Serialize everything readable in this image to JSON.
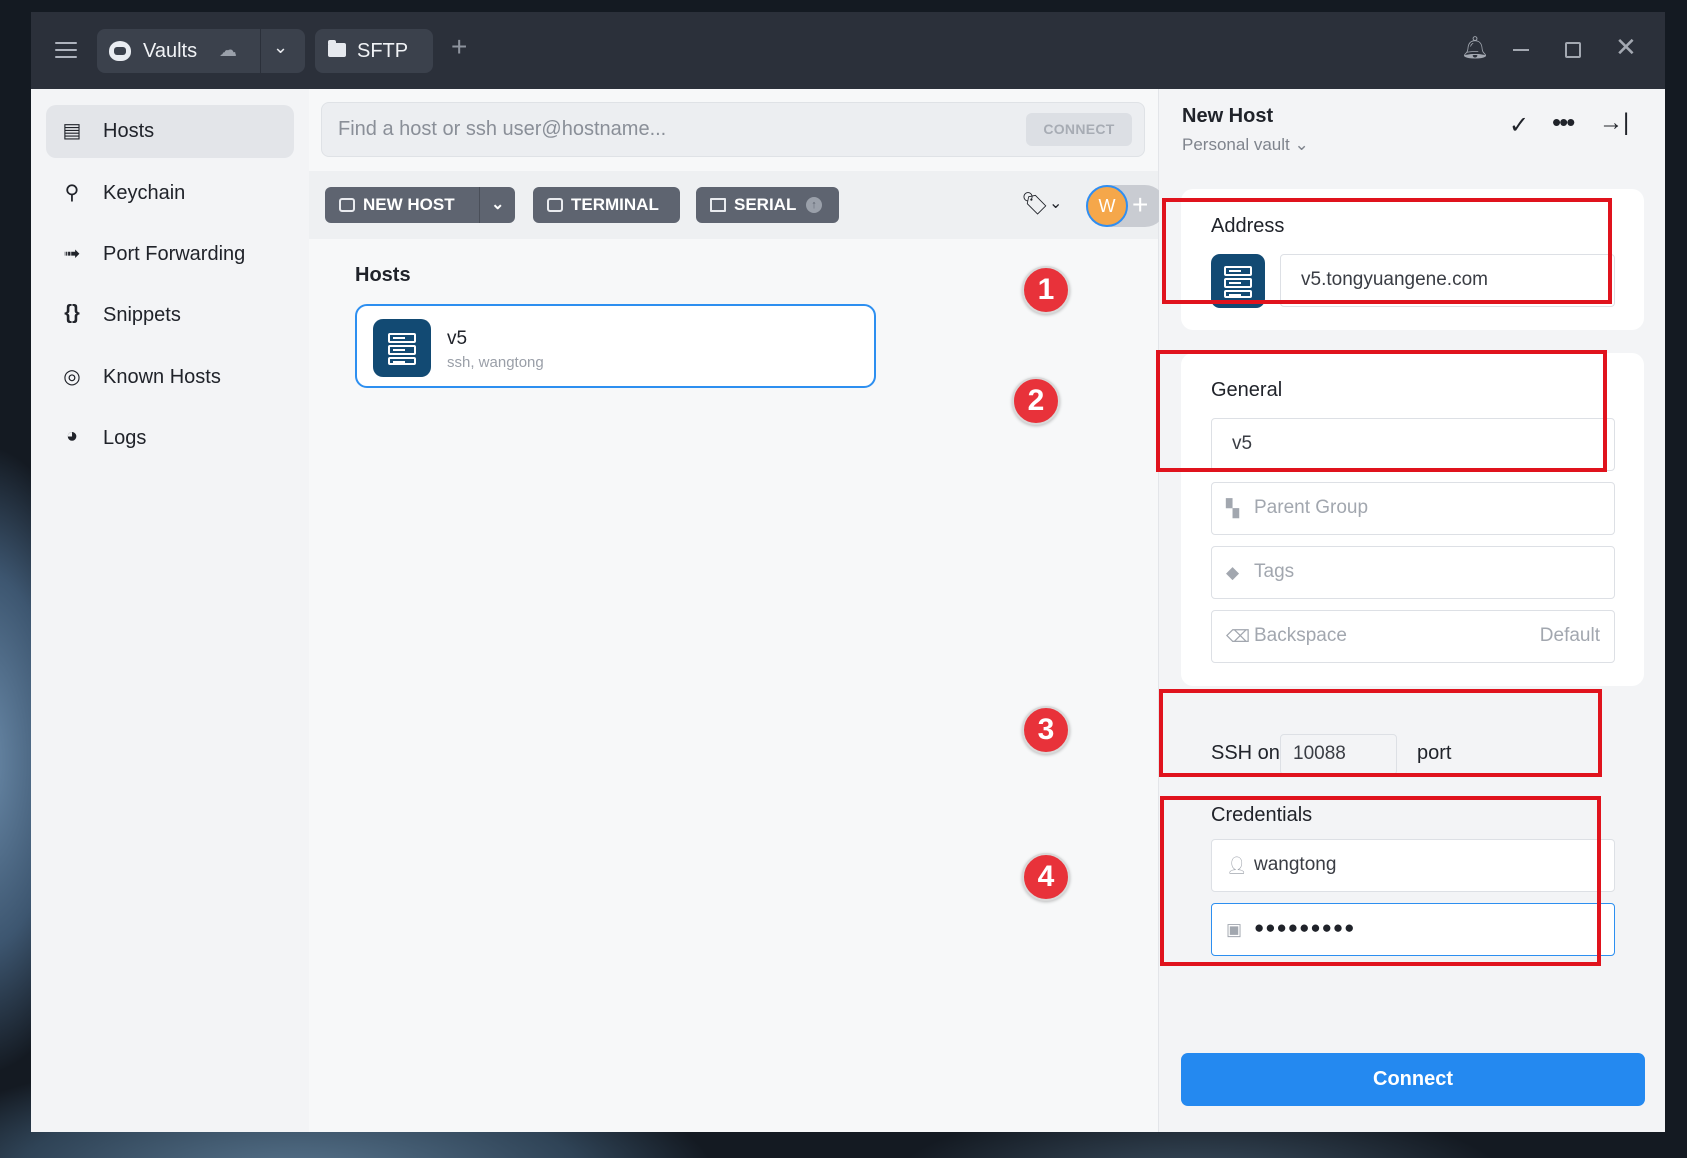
{
  "titlebar": {
    "vault_tab_label": "Vaults",
    "sftp_tab_label": "SFTP",
    "new_tab_symbol": "+"
  },
  "sidebar": {
    "items": [
      {
        "label": "Hosts",
        "icon": "hosts-icon",
        "active": true
      },
      {
        "label": "Keychain",
        "icon": "key-icon"
      },
      {
        "label": "Port Forwarding",
        "icon": "port-forwarding-icon"
      },
      {
        "label": "Snippets",
        "icon": "snippets-icon"
      },
      {
        "label": "Known Hosts",
        "icon": "fingerprint-icon"
      },
      {
        "label": "Logs",
        "icon": "clock-icon"
      }
    ]
  },
  "search": {
    "placeholder": "Find a host or ssh user@hostname...",
    "connect_label": "CONNECT"
  },
  "toolbar": {
    "new_host_label": "NEW HOST",
    "terminal_label": "TERMINAL",
    "serial_label": "SERIAL",
    "avatar_initial": "W"
  },
  "hosts": {
    "section_title": "Hosts",
    "items": [
      {
        "name": "v5",
        "subtitle": "ssh, wangtong"
      }
    ]
  },
  "badges": [
    "1",
    "2",
    "3",
    "4"
  ],
  "panel": {
    "title": "New Host",
    "vault": "Personal vault",
    "address_label": "Address",
    "address_value": "v5.tongyuangene.com",
    "general_label": "General",
    "label_value": "v5",
    "parent_group_placeholder": "Parent Group",
    "tags_placeholder": "Tags",
    "backspace_label": "Backspace",
    "backspace_value": "Default",
    "ssh_on": "SSH on",
    "port_value": "10088",
    "port_label": "port",
    "credentials_label": "Credentials",
    "username_value": "wangtong",
    "password_value": "●●●●●●●●●",
    "connect_label": "Connect"
  },
  "colors": {
    "accent": "#2489f0",
    "titlebar": "#2b303a",
    "host_icon": "#124a73",
    "annotation_red": "#e0131d"
  }
}
